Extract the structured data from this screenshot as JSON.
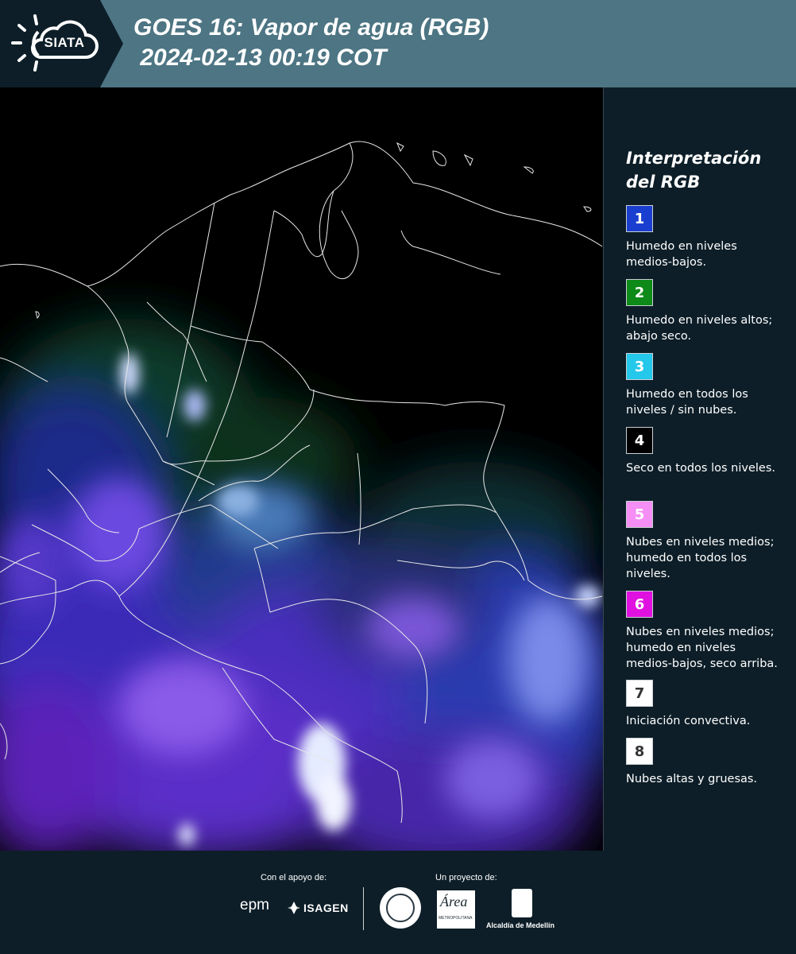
{
  "header": {
    "logo_text": "SIATA",
    "title_line1": "GOES 16: Vapor de agua (RGB)",
    "title_line2": " 2024-02-13 00:19 COT",
    "colors": {
      "bar": "#4d7583",
      "logo_panel": "#0d1e28"
    }
  },
  "legend": {
    "title": "Interpretación del RGB",
    "items": [
      {
        "number": "1",
        "color": "#1a3fd0",
        "text_color": "#ffffff",
        "description": "Humedo en niveles medios-bajos."
      },
      {
        "number": "2",
        "color": "#0d8a18",
        "text_color": "#ffffff",
        "description": "Humedo en niveles altos; abajo seco."
      },
      {
        "number": "3",
        "color": "#24c8ea",
        "text_color": "#ffffff",
        "description": "Humedo en todos los niveles / sin nubes."
      },
      {
        "number": "4",
        "color": "#000000",
        "text_color": "#ffffff",
        "description": "Seco en todos los niveles."
      },
      {
        "number": "5",
        "color": "#f58ef5",
        "text_color": "#ffffff",
        "description": "Nubes en niveles medios; humedo en todos los niveles."
      },
      {
        "number": "6",
        "color": "#e010e0",
        "text_color": "#ffffff",
        "description": "Nubes en niveles medios; humedo en niveles medios-bajos, seco arriba."
      },
      {
        "number": "7",
        "color": "#ffffff",
        "text_color": "#333333",
        "description": "Iniciación convectiva."
      },
      {
        "number": "8",
        "color": "#ffffff",
        "text_color": "#333333",
        "description": "Nubes altas y gruesas."
      }
    ]
  },
  "footer": {
    "support_label": "Con el apoyo de:",
    "project_label": "Un proyecto de:",
    "epm": "epm",
    "isagen": "ISAGEN",
    "area_logo": "Área",
    "area_sub": "METROPOLITANA",
    "alcaldia": "Alcaldía de Medellín"
  },
  "map": {
    "palette": {
      "dry": "#000000",
      "mid_moist": "#2e2fc8",
      "clouds_mid": "#8a3ad8",
      "convective": "#e8f0ff",
      "green_high": "#0f3a22",
      "cyan_moist": "#123a66"
    },
    "border_color": "#e8e8e8"
  }
}
